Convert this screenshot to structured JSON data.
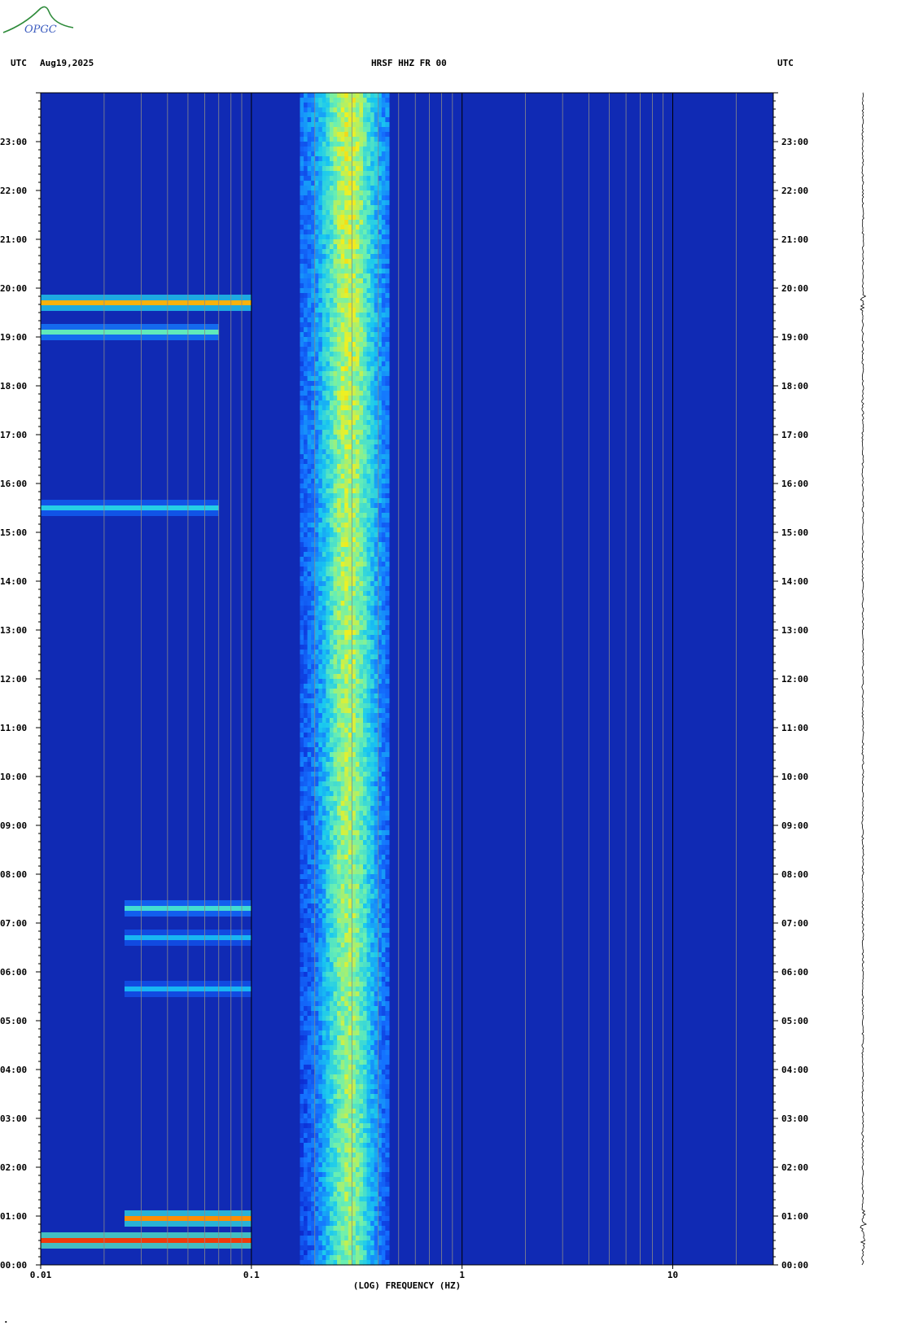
{
  "header": {
    "left_timezone": "UTC",
    "date": "Aug19,2025",
    "station": "HRSF HHZ FR 00",
    "right_timezone": "UTC"
  },
  "logo": {
    "text": "OPGC",
    "color": "#3b5bbf"
  },
  "footer_mark": "·",
  "chart_data": {
    "type": "heatmap",
    "title": "HRSF HHZ FR 00",
    "xlabel": "(LOG) FREQUENCY (HZ)",
    "ylabel": "",
    "x_scale": "log",
    "xlim": [
      0.01,
      30
    ],
    "x_ticks": [
      {
        "value": 0.01,
        "label": "0.01"
      },
      {
        "value": 0.1,
        "label": "0.1"
      },
      {
        "value": 1,
        "label": "1"
      },
      {
        "value": 10,
        "label": "10"
      }
    ],
    "ylim": [
      0,
      24
    ],
    "y_ticks": [
      {
        "value": 0,
        "label": "00:00"
      },
      {
        "value": 1,
        "label": "01:00"
      },
      {
        "value": 2,
        "label": "02:00"
      },
      {
        "value": 3,
        "label": "03:00"
      },
      {
        "value": 4,
        "label": "04:00"
      },
      {
        "value": 5,
        "label": "05:00"
      },
      {
        "value": 6,
        "label": "06:00"
      },
      {
        "value": 7,
        "label": "07:00"
      },
      {
        "value": 8,
        "label": "08:00"
      },
      {
        "value": 9,
        "label": "09:00"
      },
      {
        "value": 10,
        "label": "10:00"
      },
      {
        "value": 11,
        "label": "11:00"
      },
      {
        "value": 12,
        "label": "12:00"
      },
      {
        "value": 13,
        "label": "13:00"
      },
      {
        "value": 14,
        "label": "14:00"
      },
      {
        "value": 15,
        "label": "15:00"
      },
      {
        "value": 16,
        "label": "16:00"
      },
      {
        "value": 17,
        "label": "17:00"
      },
      {
        "value": 18,
        "label": "18:00"
      },
      {
        "value": 19,
        "label": "19:00"
      },
      {
        "value": 20,
        "label": "20:00"
      },
      {
        "value": 21,
        "label": "21:00"
      },
      {
        "value": 22,
        "label": "22:00"
      },
      {
        "value": 23,
        "label": "23:00"
      }
    ],
    "grid": true,
    "colormap": [
      "#0a1580",
      "#0d2fd6",
      "#1470ff",
      "#19c8f0",
      "#6cf0b0",
      "#f0f020",
      "#ff8800",
      "#e81010"
    ],
    "background_color": "#102ab4",
    "microseism_band_hz": [
      0.17,
      0.45
    ],
    "microseism_peak_hz": 0.29,
    "events": [
      {
        "time_h": 0.5,
        "fmin": 0.01,
        "fmax": 0.1,
        "intensity": 0.95
      },
      {
        "time_h": 0.95,
        "fmin": 0.025,
        "fmax": 0.1,
        "intensity": 0.85
      },
      {
        "time_h": 5.65,
        "fmin": 0.025,
        "fmax": 0.1,
        "intensity": 0.4
      },
      {
        "time_h": 6.7,
        "fmin": 0.025,
        "fmax": 0.1,
        "intensity": 0.4
      },
      {
        "time_h": 7.3,
        "fmin": 0.025,
        "fmax": 0.1,
        "intensity": 0.5
      },
      {
        "time_h": 15.5,
        "fmin": 0.01,
        "fmax": 0.07,
        "intensity": 0.45
      },
      {
        "time_h": 19.1,
        "fmin": 0.01,
        "fmax": 0.07,
        "intensity": 0.55
      },
      {
        "time_h": 19.7,
        "fmin": 0.01,
        "fmax": 0.1,
        "intensity": 0.8
      }
    ]
  }
}
